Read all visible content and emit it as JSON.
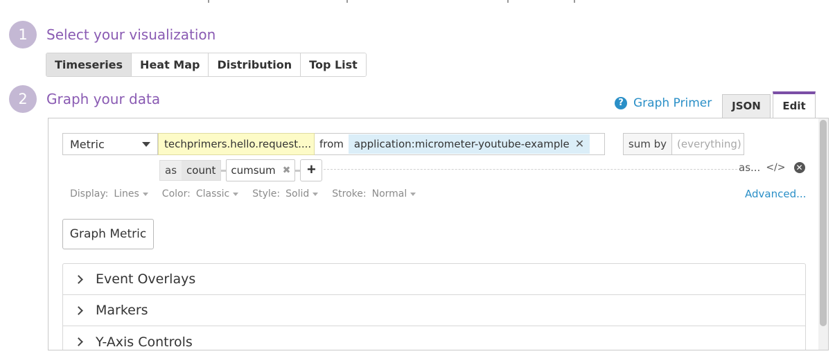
{
  "steps": [
    {
      "number": "1",
      "title": "Select your visualization"
    },
    {
      "number": "2",
      "title": "Graph your data"
    }
  ],
  "visualization_tabs": [
    "Timeseries",
    "Heat Map",
    "Distribution",
    "Top List"
  ],
  "active_visualization": "Timeseries",
  "graph_primer": {
    "icon": "question-icon",
    "label": "Graph Primer"
  },
  "editor_tabs": {
    "json": "JSON",
    "edit": "Edit",
    "active": "Edit"
  },
  "query": {
    "source_type": "Metric",
    "metric_name": "techprimers.hello.request....",
    "from_label": "from",
    "tags": [
      "application:micrometer-youtube-example"
    ],
    "sum_by_label": "sum by",
    "sum_by_placeholder": "(everything)",
    "as_label": "as",
    "as_value": "count",
    "function": "cumsum",
    "alias_label": "as..."
  },
  "display_options": {
    "display": {
      "label": "Display:",
      "value": "Lines"
    },
    "color": {
      "label": "Color:",
      "value": "Classic"
    },
    "style": {
      "label": "Style:",
      "value": "Solid"
    },
    "stroke": {
      "label": "Stroke:",
      "value": "Normal"
    }
  },
  "advanced_label": "Advanced...",
  "graph_metric_button": "Graph Metric",
  "sections": [
    "Event Overlays",
    "Markers",
    "Y-Axis Controls"
  ],
  "colors": {
    "accent_purple": "#8a5bb3",
    "step_circle": "#c4b8d4",
    "link_blue": "#2a8fc7",
    "metric_highlight": "#fdfbc7",
    "tag_chip": "#dbeef8"
  }
}
